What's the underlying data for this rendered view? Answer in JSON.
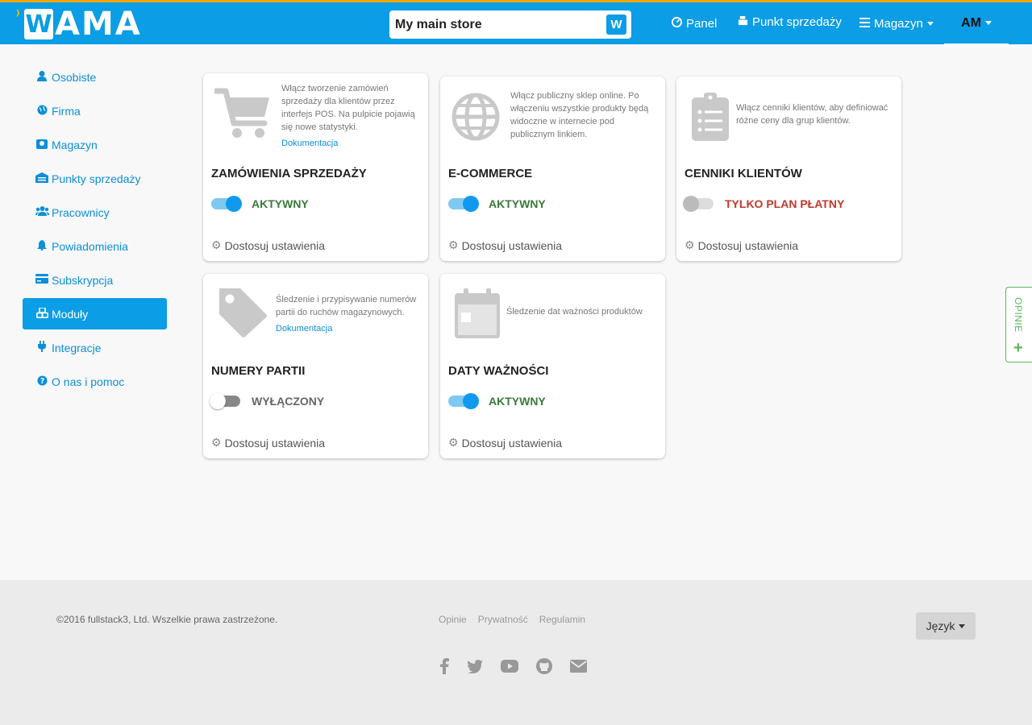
{
  "header": {
    "logo_w": "W",
    "logo_text": "AMA",
    "store": {
      "value": "My main store",
      "button_label": "W"
    },
    "nav": [
      {
        "label": "Panel"
      },
      {
        "label": "Punkt sprzedaży"
      },
      {
        "label": "Magazyn"
      }
    ],
    "user_label": "AM"
  },
  "sidebar": {
    "items": [
      {
        "label": "Osobiste"
      },
      {
        "label": "Firma"
      },
      {
        "label": "Magazyn"
      },
      {
        "label": "Punkty sprzedaży"
      },
      {
        "label": "Pracownicy"
      },
      {
        "label": "Powiadomienia"
      },
      {
        "label": "Subskrypcja"
      },
      {
        "label": "Moduły"
      },
      {
        "label": "Integracje"
      },
      {
        "label": "O nas i pomoc"
      }
    ]
  },
  "modules": [
    {
      "title": "ZAMÓWIENIA SPRZEDAŻY",
      "description": "Włącz tworzenie zamówień sprzedaży dla klientów przez interfejs POS. Na pulpicie pojawią się nowe statystyki.",
      "doc_link": "Dokumentacja",
      "status": "AKTYWNY",
      "settings": "Dostosuj ustawienia",
      "icon": "cart-icon"
    },
    {
      "title": "E-COMMERCE",
      "description": "Włącz publiczny sklep online. Po włączeniu wszystkie produkty będą widoczne w internecie pod publicznym linkiem.",
      "status": "AKTYWNY",
      "settings": "Dostosuj ustawienia",
      "icon": "globe-icon"
    },
    {
      "title": "CENNIKI KLIENTÓW",
      "description": "Włącz cenniki klientów, aby definiować różne ceny dla grup klientów.",
      "status": "TYLKO PLAN PŁATNY",
      "settings": "Dostosuj ustawienia",
      "icon": "clipboard-list-icon"
    },
    {
      "title": "NUMERY PARTII",
      "description": "Śledzenie i przypisywanie numerów partii do ruchów magazynowych.",
      "doc_link": "Dokumentacja",
      "status": "WYŁĄCZONY",
      "settings": "Dostosuj ustawienia",
      "icon": "tag-icon"
    },
    {
      "title": "DATY WAŻNOŚCI",
      "description": "Śledzenie dat ważności produktów",
      "status": "AKTYWNY",
      "settings": "Dostosuj ustawienia",
      "icon": "calendar-icon"
    }
  ],
  "feedback_tab": {
    "label": "OPINIE",
    "plus": "+"
  },
  "footer": {
    "copyright": "©2016 fullstack3, Ltd. Wszelkie prawa zastrzeżone.",
    "links": [
      "Opinie",
      "Prywatność",
      "Regulamin"
    ],
    "language_button": "Język",
    "social": [
      "facebook-icon",
      "twitter-icon",
      "youtube-icon",
      "github-icon",
      "envelope-icon"
    ]
  },
  "colors": {
    "primary": "#0b9de5",
    "accent": "#f0a500",
    "active_green": "#3a7a3a",
    "paid_red": "#c0392b",
    "feedback_green": "#5cb85c"
  }
}
